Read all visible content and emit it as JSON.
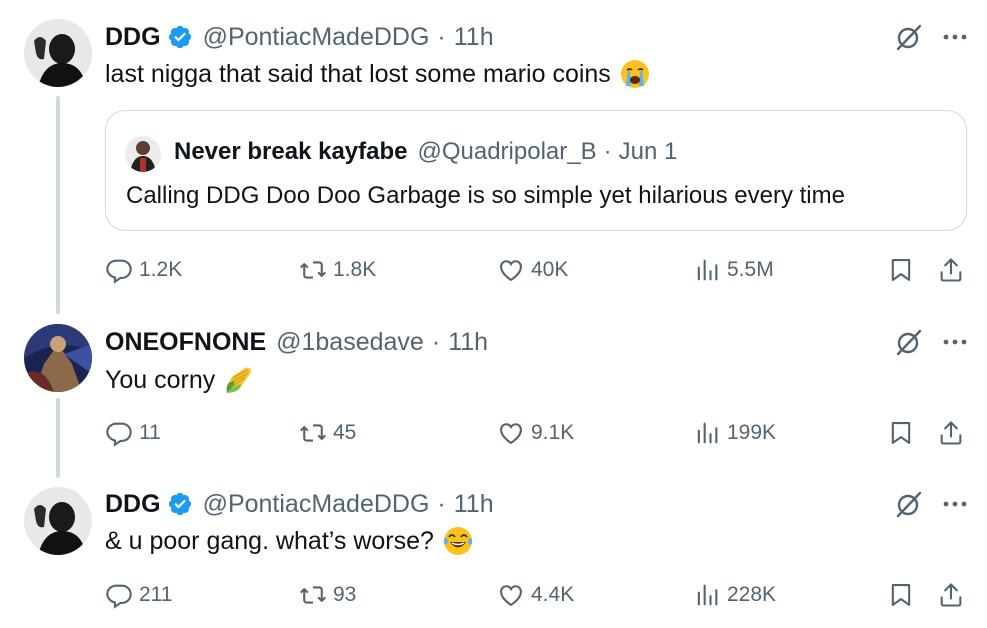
{
  "tweets": [
    {
      "name": "DDG",
      "handle": "@PontiacMadeDDG",
      "dot": "·",
      "time": "11h",
      "text": "last nigga that said that lost some mario coins",
      "emoji": "loudly-crying-face",
      "quote": {
        "name": "Never break kayfabe",
        "handle": "@Quadripolar_B",
        "dot": "·",
        "time": "Jun 1",
        "text": "Calling DDG Doo Doo Garbage is so simple yet hilarious every time"
      },
      "stats": {
        "replies": "1.2K",
        "reposts": "1.8K",
        "likes": "40K",
        "views": "5.5M"
      }
    },
    {
      "name": "ONEOFNONE",
      "handle": "@1basedave",
      "dot": "·",
      "time": "11h",
      "text": "You corny",
      "emoji": "ear-of-corn",
      "stats": {
        "replies": "11",
        "reposts": "45",
        "likes": "9.1K",
        "views": "199K"
      }
    },
    {
      "name": "DDG",
      "handle": "@PontiacMadeDDG",
      "dot": "·",
      "time": "11h",
      "text": "& u poor gang. what’s worse?",
      "emoji": "face-with-tears-of-joy",
      "stats": {
        "replies": "211",
        "reposts": "93",
        "likes": "4.4K",
        "views": "228K"
      }
    }
  ],
  "colors": {
    "text": "#0f1419",
    "secondary": "#536471",
    "verified": "#1d9bf0",
    "thread_line": "#cfd9de"
  }
}
